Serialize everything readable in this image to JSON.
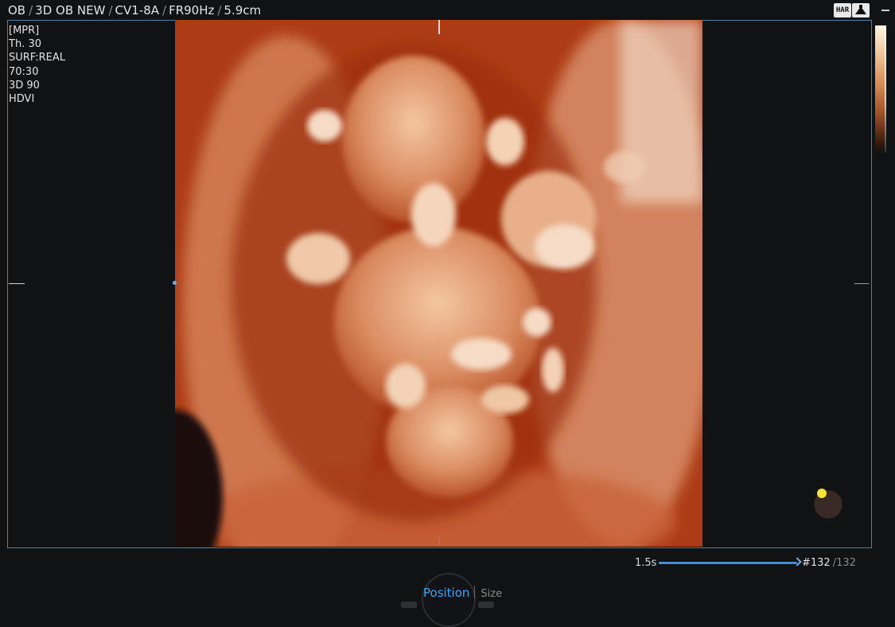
{
  "header": {
    "path": [
      "OB",
      "3D OB NEW",
      "CV1-8A",
      "FR90Hz",
      "5.9cm"
    ],
    "separator": "/",
    "har_badge": "HAR",
    "probe_icon": "probe-icon"
  },
  "params": [
    "[MPR]",
    "Th. 30",
    "SURF:REAL",
    "70:30",
    "3D 90",
    "HDVI"
  ],
  "image": {
    "description_icon": "fetal-3d-render",
    "tint": "#b8431c"
  },
  "cine": {
    "time": "1.5s",
    "frame": "#132",
    "total": "/132",
    "progress": 1.0
  },
  "knob": {
    "active_label": "Position",
    "inactive_label": "Size"
  },
  "colors": {
    "accent": "#49a3f0",
    "frame_border": "#5b7f9a",
    "background": "#111214"
  }
}
